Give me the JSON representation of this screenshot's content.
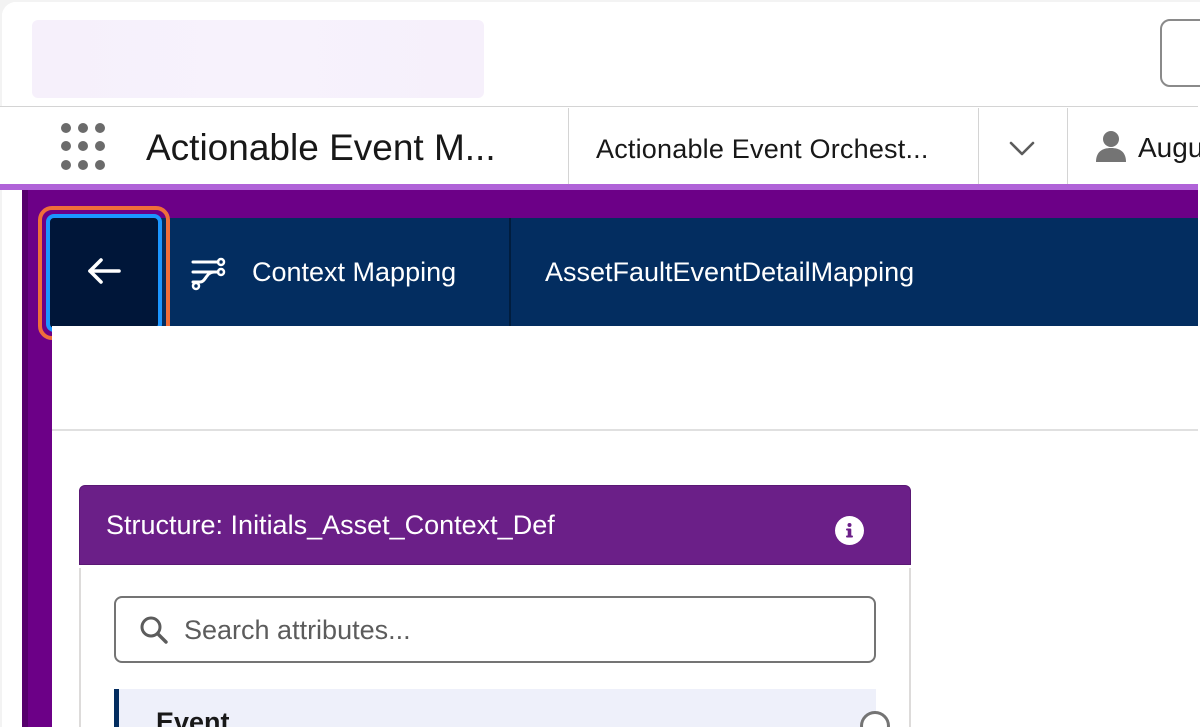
{
  "app_nav": {
    "app_name": "Actionable Event M...",
    "tab_label": "Actionable Event Orchest...",
    "user_label": "Augu"
  },
  "builder_header": {
    "section_label": "Context Mapping",
    "mapping_name": "AssetFaultEventDetailMapping"
  },
  "structure_panel": {
    "title": "Structure: Initials_Asset_Context_Def",
    "search_placeholder": "Search attributes...",
    "tree_items": [
      {
        "label": "Event"
      }
    ]
  },
  "colors": {
    "purple_frame": "#6c0087",
    "header_navy": "#032d60",
    "structure_header": "#6b1f88",
    "focus_ring": "#ef6e3a",
    "focus_inner": "#1b96ff",
    "nav_accent": "#b063d8"
  },
  "icons": {
    "app_launcher": "waffle-icon",
    "tab_menu": "chevron-down-icon",
    "user": "user-icon",
    "back": "arrow-left-icon",
    "context_mapping": "flow-icon",
    "info": "info-icon",
    "search": "search-icon"
  }
}
